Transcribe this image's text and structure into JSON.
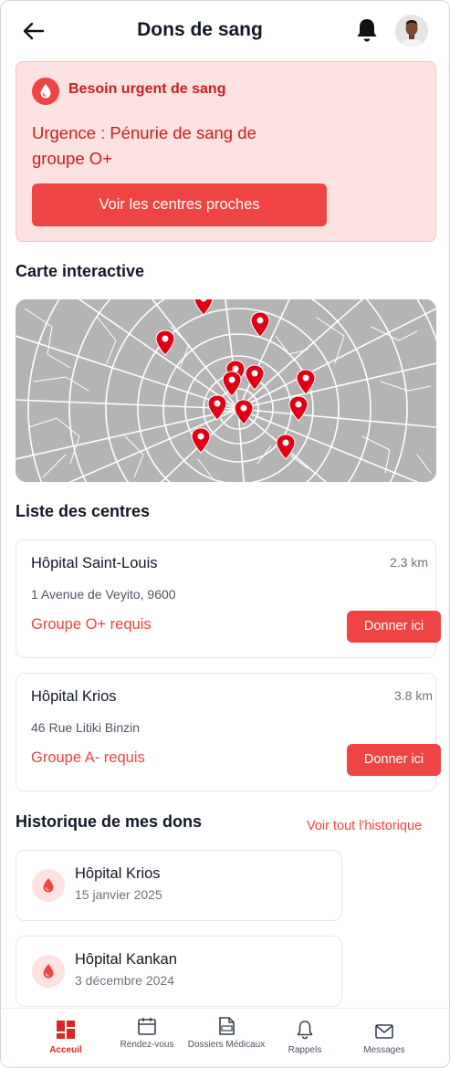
{
  "header": {
    "title": "Dons de sang"
  },
  "alert": {
    "title": "Besoin urgent de sang",
    "message": "Urgence : Pénurie de sang de groupe O+",
    "button_label": "Voir les centres proches"
  },
  "map_section": {
    "title": "Carte interactive"
  },
  "centers_section": {
    "title": "Liste des centres",
    "centers": [
      {
        "name": "Hôpital Saint-Louis",
        "distance": "2.3 km",
        "address": "1 Avenue de Veyito, 9600",
        "group": "Groupe O+ requis",
        "button_label": "Donner ici"
      },
      {
        "name": "Hôpital Krios",
        "distance": "3.8 km",
        "address": "46 Rue Litiki Binzin",
        "group": "Groupe A- requis",
        "button_label": "Donner ici"
      }
    ]
  },
  "history_section": {
    "title": "Historique de mes dons",
    "link_label": "Voir tout l'historique",
    "items": [
      {
        "name": "Hôpital Krios",
        "date": "15 janvier 2025"
      },
      {
        "name": "Hôpital Kankan",
        "date": "3 décembre 2024"
      }
    ]
  },
  "bottom_nav": {
    "items": [
      {
        "label": "Acceuil",
        "icon": "home-grid-icon",
        "active": true
      },
      {
        "label": "Rendez-vous",
        "icon": "calendar-icon",
        "active": false
      },
      {
        "label": "Dossiers Médicaux",
        "icon": "medical-file-icon",
        "active": false
      },
      {
        "label": "Rappels",
        "icon": "bell-icon",
        "active": false
      },
      {
        "label": "Messages",
        "icon": "envelope-icon",
        "active": false
      }
    ]
  },
  "colors": {
    "accent": "#ef4444",
    "alert_background": "#fde2e2",
    "alert_text": "#c81e1e",
    "map_background": "#b4b4b4",
    "map_pin": "#e00012"
  }
}
